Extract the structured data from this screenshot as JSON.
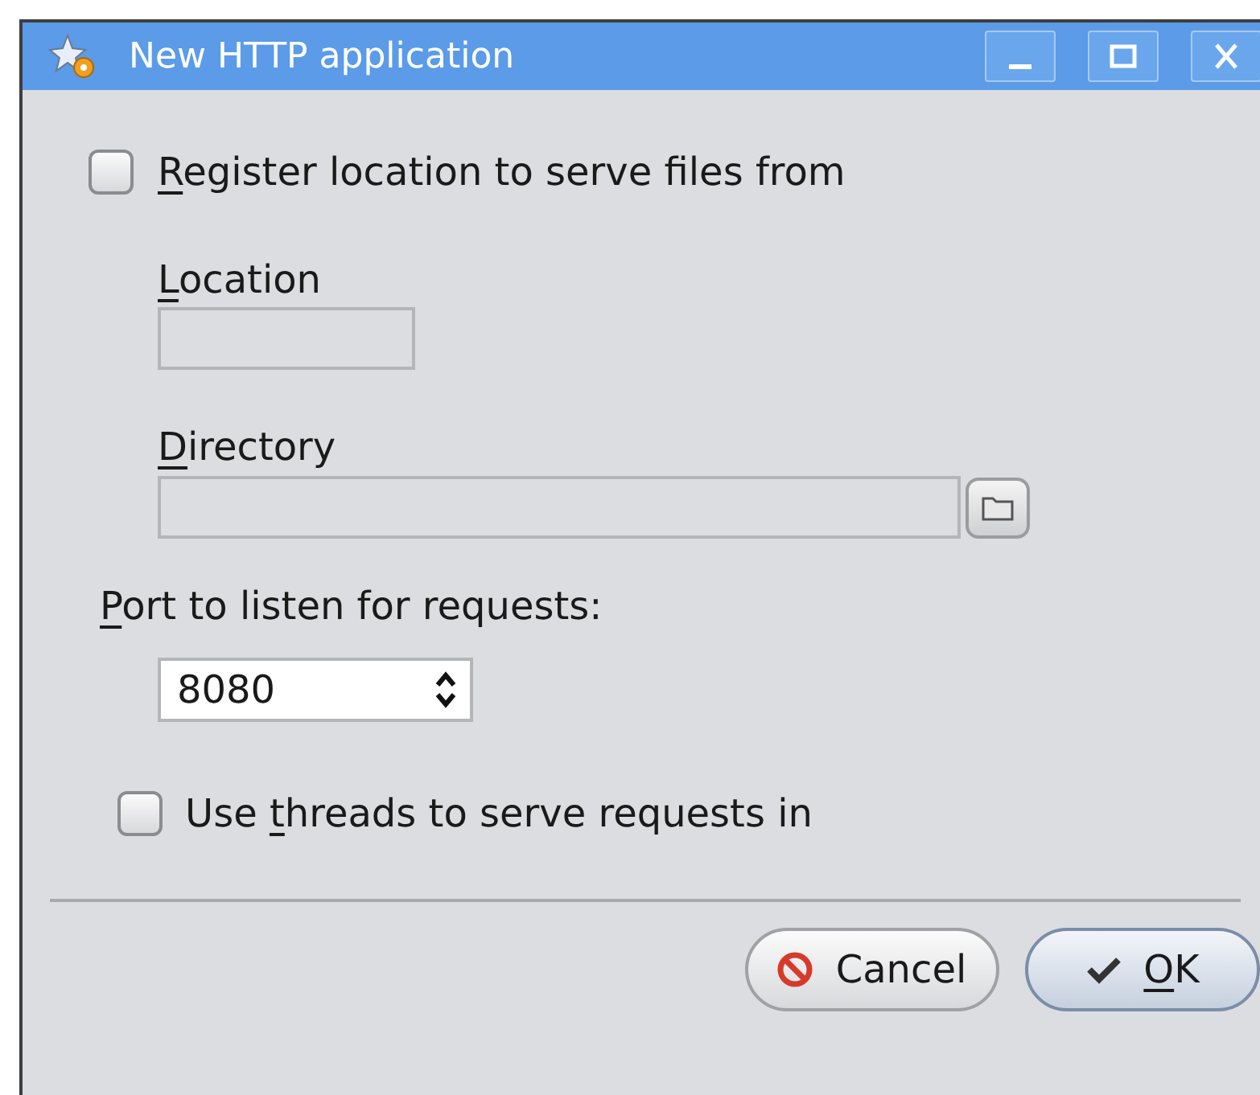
{
  "window": {
    "title": "New HTTP application"
  },
  "register": {
    "label": {
      "key": "R",
      "after": "egister location to serve files from"
    },
    "checked": false
  },
  "location": {
    "label": {
      "key": "L",
      "after": "ocation"
    },
    "disabled": true
  },
  "directory": {
    "label": {
      "key": "D",
      "after": "irectory"
    },
    "disabled": true
  },
  "port": {
    "label": {
      "key": "P",
      "after": "ort to listen for requests:"
    },
    "value": "8080"
  },
  "threads": {
    "label": {
      "before": "Use ",
      "key": "t",
      "after": "hreads to serve requests in"
    },
    "checked": false
  },
  "buttons": [
    {
      "kind": "cancel",
      "label": {
        "before": "Cancel"
      }
    },
    {
      "kind": "ok",
      "label": {
        "key": "O",
        "after": "K"
      }
    }
  ]
}
